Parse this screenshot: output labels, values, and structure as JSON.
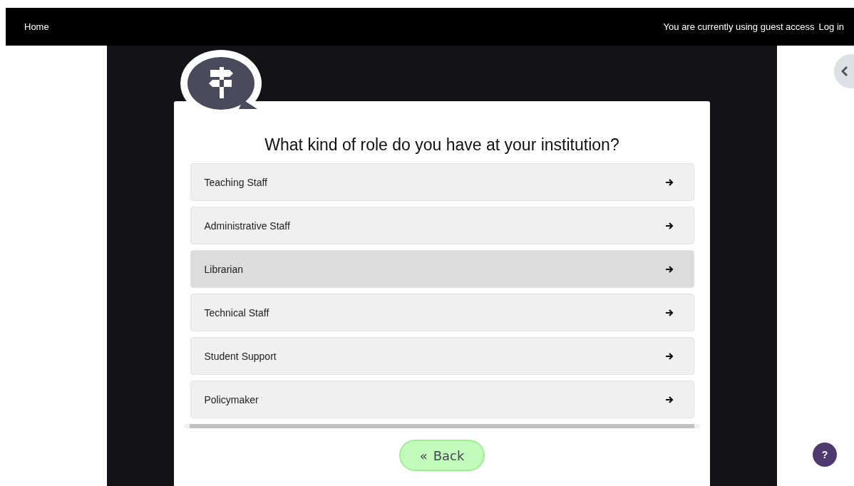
{
  "navbar": {
    "home": "Home",
    "guest_notice": "You are currently using guest access",
    "login": "Log in"
  },
  "question": {
    "title": "What kind of role do you have at your institution?",
    "options": [
      {
        "label": "Teaching Staff",
        "hovered": false
      },
      {
        "label": "Administrative Staff",
        "hovered": false
      },
      {
        "label": "Librarian",
        "hovered": true
      },
      {
        "label": "Technical Staff",
        "hovered": false
      },
      {
        "label": "Student Support",
        "hovered": false
      },
      {
        "label": "Policymaker",
        "hovered": false
      }
    ],
    "back_button": {
      "icon": "«",
      "label": "Back"
    }
  },
  "help_button": {
    "label": "?"
  }
}
